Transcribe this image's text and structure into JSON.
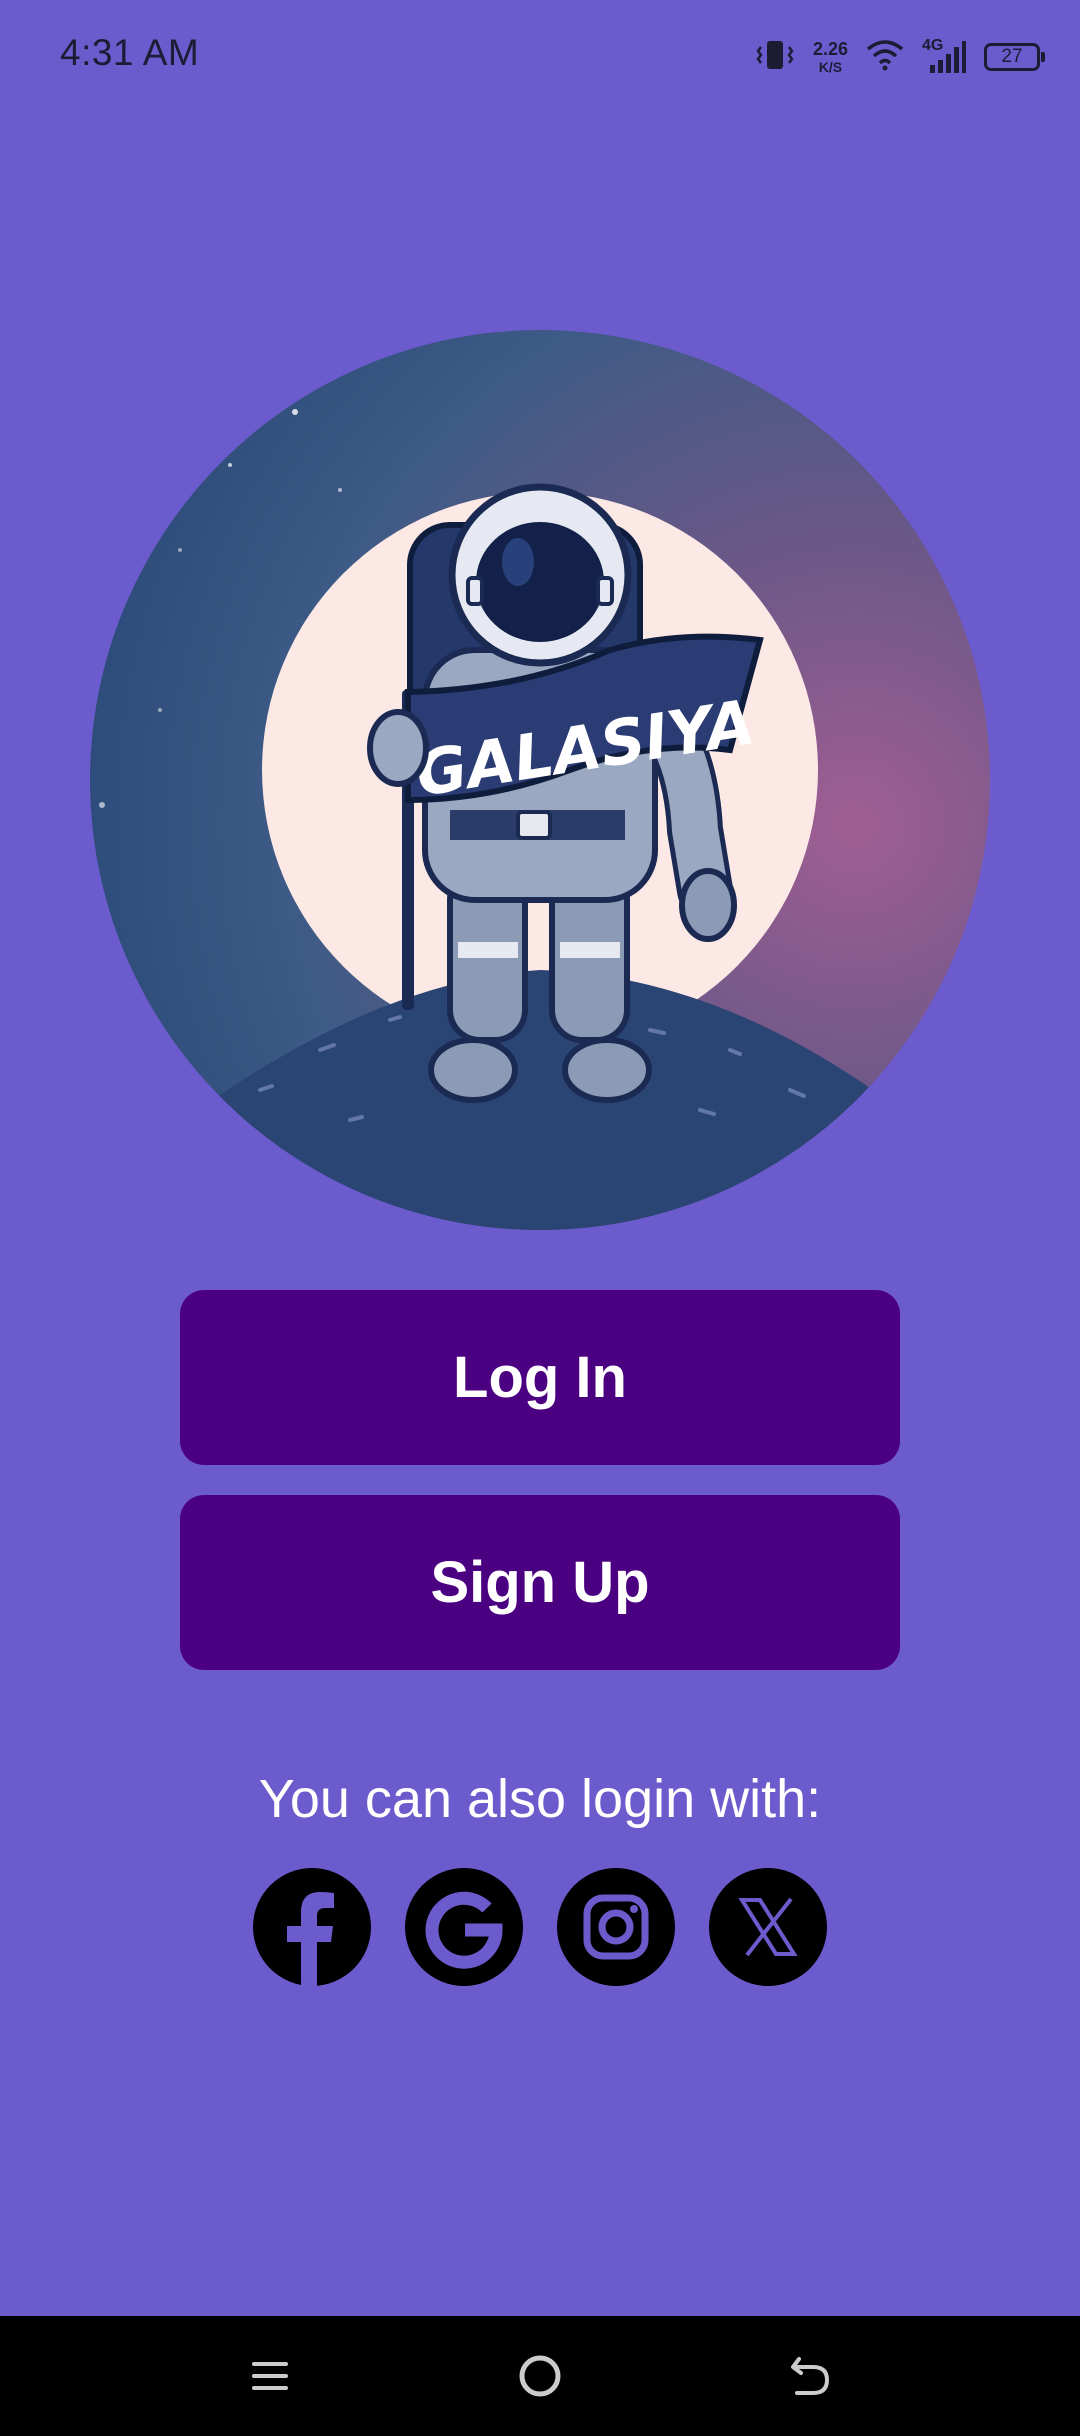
{
  "status_bar": {
    "time": "4:31 AM",
    "net_speed_value": "2.26",
    "net_speed_unit": "K/S",
    "network_type": "4G",
    "battery_level": "27",
    "icons": [
      "vibrate-icon",
      "wifi-icon",
      "signal-icon",
      "battery-icon"
    ]
  },
  "hero": {
    "logo_text": "GALASIYA"
  },
  "buttons": {
    "login_label": "Log In",
    "signup_label": "Sign Up"
  },
  "alt_login": {
    "text": "You can also login with:",
    "providers": [
      "facebook-icon",
      "google-icon",
      "instagram-icon",
      "x-icon"
    ]
  },
  "nav_bar": {
    "icons": [
      "menu-icon",
      "home-icon",
      "back-icon"
    ]
  },
  "colors": {
    "background": "#6B5BCD",
    "button": "#4B0082",
    "button_text": "#FFFFFF",
    "nav_bar": "#000000"
  }
}
